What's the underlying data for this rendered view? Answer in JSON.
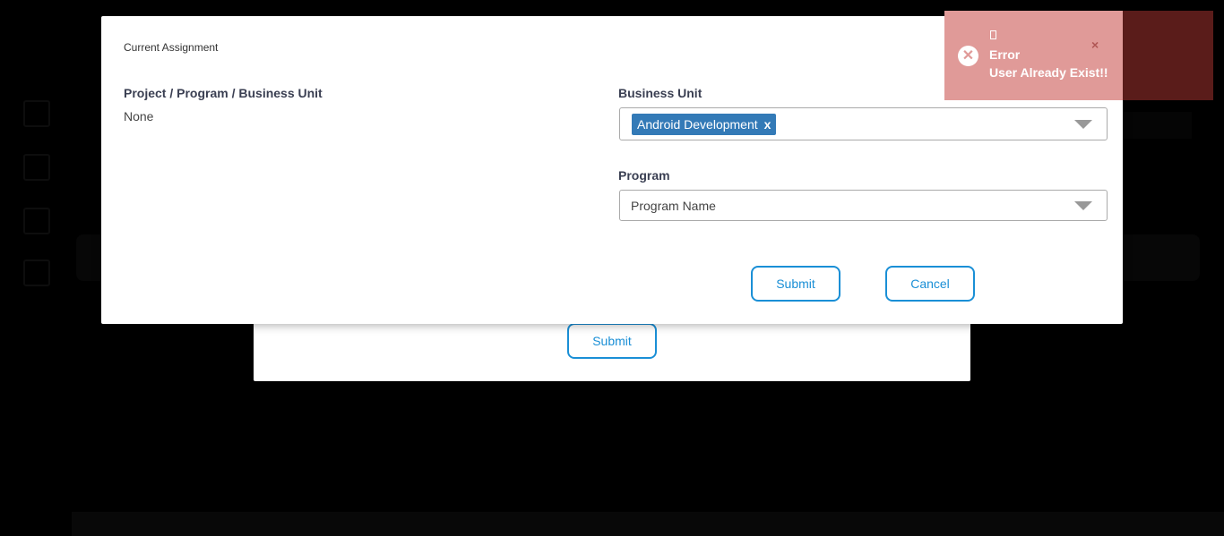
{
  "modal": {
    "title": "Current Assignment",
    "left_label": "Project / Program / Business Unit",
    "left_value": "None",
    "business_unit": {
      "label": "Business Unit",
      "selected_chips": [
        "Android Development"
      ],
      "chip_remove_label": "x"
    },
    "program": {
      "label": "Program",
      "placeholder": "Program Name"
    },
    "submit_label": "Submit",
    "cancel_label": "Cancel"
  },
  "background_modal": {
    "submit_label": "Submit"
  },
  "toast": {
    "type": "error",
    "title": "Error",
    "message": "User Already Exist!!",
    "close_label": "×",
    "icon": "error-circle-icon",
    "color": "#e09a98"
  },
  "colors": {
    "accent": "#1a8fd6",
    "chip": "#337ab7",
    "backdrop": "#000000"
  }
}
